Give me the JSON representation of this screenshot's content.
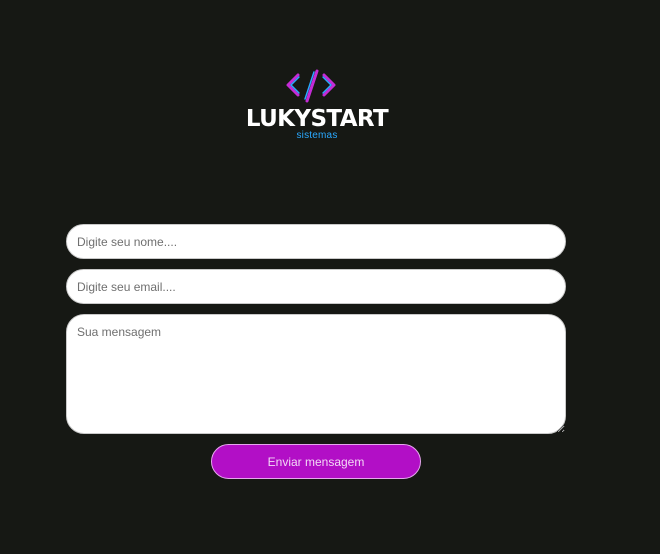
{
  "brand": {
    "name": "LUKYSTART",
    "subtitle": "sistemas",
    "logo_icon": "code-brackets-icon",
    "colors": {
      "icon_magenta": "#c42bd6",
      "icon_blue": "#2aa9ff",
      "subtitle_blue": "#2aa9ff",
      "wordmark": "#ffffff"
    }
  },
  "form": {
    "name_placeholder": "Digite seu nome....",
    "email_placeholder": "Digite seu email....",
    "message_placeholder": "Sua mensagem",
    "submit_label": "Enviar mensagem"
  },
  "theme": {
    "background": "#161814",
    "button_background": "#b20fc6",
    "button_text": "#f3d8f6"
  }
}
